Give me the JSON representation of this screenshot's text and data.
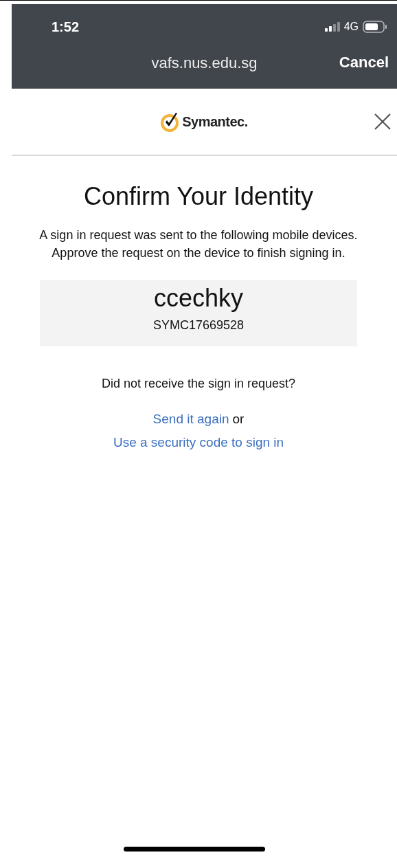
{
  "status_bar": {
    "time": "1:52",
    "network": "4G"
  },
  "browser_bar": {
    "url": "vafs.nus.edu.sg",
    "cancel": "Cancel"
  },
  "header": {
    "logo_text": "Symantec."
  },
  "title": "Confirm Your Identity",
  "message": "A sign in request was sent to the following mobile devices. Approve the request on the device to finish signing in.",
  "device": {
    "user": "ccechky",
    "id": "SYMC17669528"
  },
  "help": {
    "question": "Did not receive the sign in request?",
    "resend_link": "Send it again",
    "joiner": "or",
    "code_link": "Use a security code to sign in"
  }
}
